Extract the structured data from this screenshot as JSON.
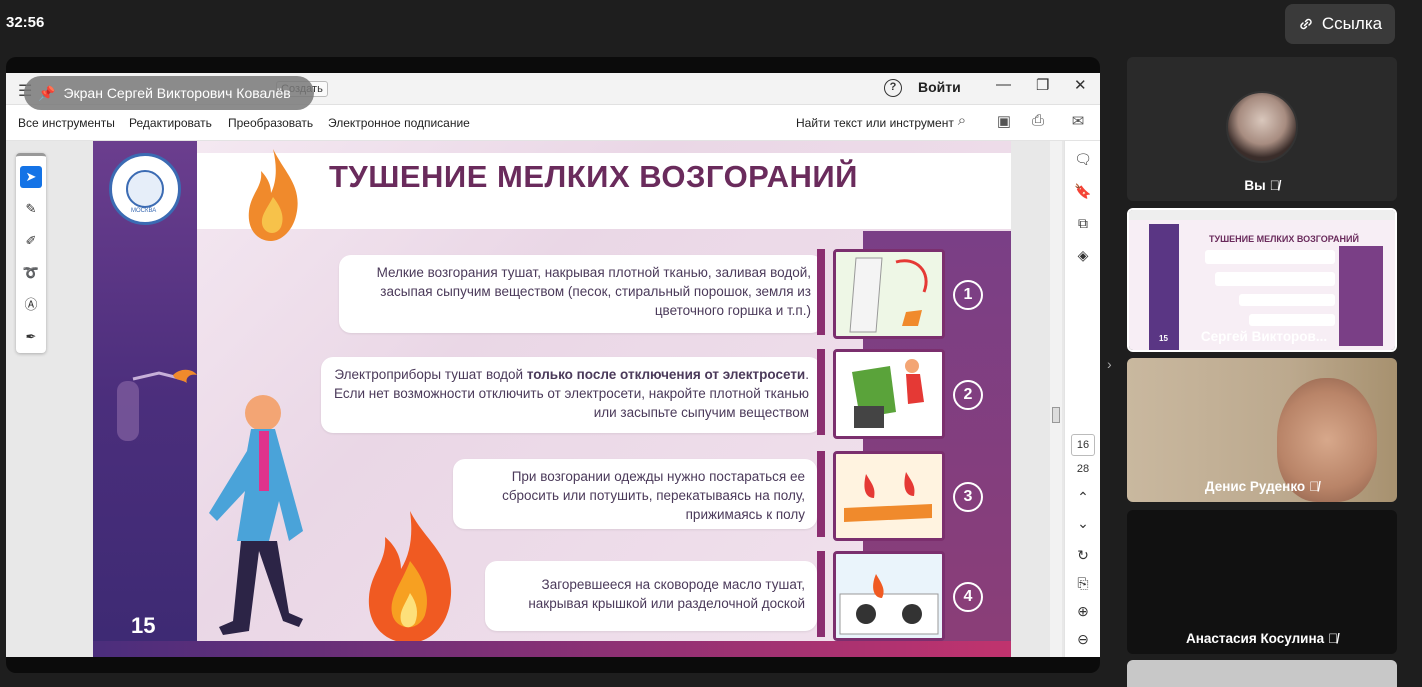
{
  "topbar": {
    "timer": "32:56",
    "link_label": "Ссылка"
  },
  "share_pill": {
    "label": "Экран Сергей Викторович Ковалёв"
  },
  "pdf": {
    "create_chip": "Создать",
    "help_glyph": "?",
    "login": "Войти",
    "tools": [
      "Все инструменты",
      "Редактировать",
      "Преобразовать",
      "Электронное подписание"
    ],
    "find_text": "Найти текст или инструмент",
    "page_current": "16",
    "page_total": "28"
  },
  "slide": {
    "title": "ТУШЕНИЕ МЕЛКИХ ВОЗГОРАНИЙ",
    "logo_text": "МОСКВА",
    "slide_number": "15",
    "steps": [
      {
        "num": "1",
        "text": "Мелкие возгорания тушат, накрывая плотной тканью, заливая водой, засыпая сыпучим веществом (песок, стиральный порошок, земля из цветочного горшка и т.п.)"
      },
      {
        "num": "2",
        "text_a": "Электроприборы тушат водой ",
        "text_bold": "только после отключения от электросети",
        "text_b": ". Если нет возможности отключить от электросети, накройте плотной тканью или засыпьте сыпучим веществом"
      },
      {
        "num": "3",
        "text": "При возгорании одежды нужно постараться ее сбросить или потушить, перекатываясь на полу, прижимаясь к полу"
      },
      {
        "num": "4",
        "text": "Загоревшееся на сковороде масло тушат, накрывая крышкой или разделочной доской"
      }
    ]
  },
  "participants": [
    {
      "name": "Вы",
      "muted": true
    },
    {
      "name": "Сергей Викторов...",
      "muted": false,
      "thumb_title": "ТУШЕНИЕ МЕЛКИХ ВОЗГОРАНИЙ",
      "thumb_num": "15"
    },
    {
      "name": "Денис Руденко",
      "muted": true
    },
    {
      "name": "Анастасия Косулина",
      "muted": true
    }
  ],
  "colors": {
    "accent": "#6a2b5c",
    "purple_band": "#4b2e7c",
    "tool_active": "#1473e6"
  }
}
